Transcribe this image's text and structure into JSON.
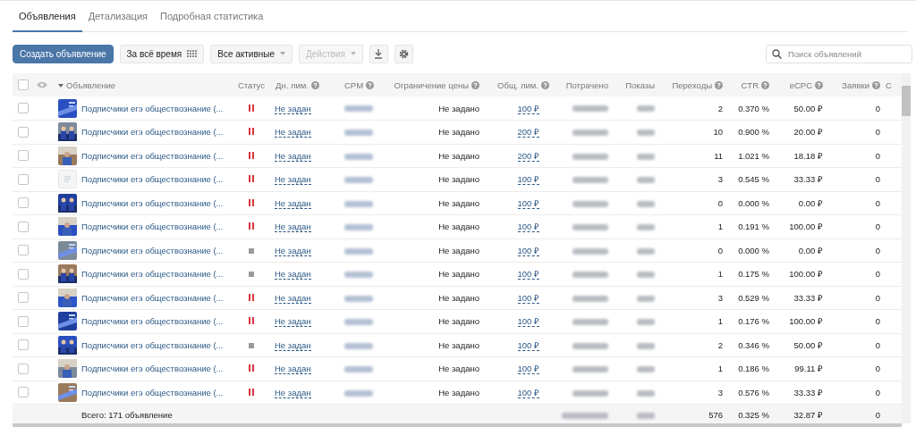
{
  "tabs": [
    {
      "label": "Объявления",
      "selected": true
    },
    {
      "label": "Детализация",
      "selected": false
    },
    {
      "label": "Подробная статистика",
      "selected": false
    }
  ],
  "toolbar": {
    "create_button": "Создать объявление",
    "period": "За всё время",
    "filter": "Все активные",
    "actions": {
      "label": "Действия",
      "disabled": true
    }
  },
  "search": {
    "placeholder": "Поиск объявлений"
  },
  "table": {
    "select_all": {
      "checked": false
    },
    "columns": [
      {
        "label": "Объявление",
        "help": false,
        "sorted": true
      },
      {
        "label": "Статус",
        "help": false,
        "sorted": false
      },
      {
        "label": "Дн. лим.",
        "help": true,
        "sorted": false
      },
      {
        "label": "CPM",
        "help": true,
        "sorted": false
      },
      {
        "label": "Ограничение цены",
        "help": true,
        "sorted": false
      },
      {
        "label": "Общ. лим.",
        "help": true,
        "sorted": false
      },
      {
        "label": "Потрачено",
        "help": false,
        "sorted": false
      },
      {
        "label": "Показы",
        "help": false,
        "sorted": false
      },
      {
        "label": "Переходы",
        "help": true,
        "sorted": false
      },
      {
        "label": "CTR",
        "help": true,
        "sorted": false
      },
      {
        "label": "eCPC",
        "help": true,
        "sorted": false
      },
      {
        "label": "Заявки",
        "help": true,
        "sorted": false
      },
      {
        "label": "С",
        "help": false,
        "sorted": false
      }
    ],
    "rows": [
      {
        "checked": false,
        "has_image": true,
        "title": "Подписчики егэ обществознание (...",
        "paused": true,
        "daily_limit": "Не задан",
        "price_limit": "Не задано",
        "total_limit": "100 ₽",
        "clicks": "2",
        "ctr": "0.370 %",
        "ecpc": "50.00 ₽",
        "leads": "0"
      },
      {
        "checked": false,
        "has_image": true,
        "title": "Подписчики егэ обществознание (...",
        "paused": true,
        "daily_limit": "Не задан",
        "price_limit": "Не задано",
        "total_limit": "200 ₽",
        "clicks": "10",
        "ctr": "0.900 %",
        "ecpc": "20.00 ₽",
        "leads": "0"
      },
      {
        "checked": false,
        "has_image": true,
        "title": "Подписчики егэ обществознание (...",
        "paused": true,
        "daily_limit": "Не задан",
        "price_limit": "Не задано",
        "total_limit": "200 ₽",
        "clicks": "11",
        "ctr": "1.021 %",
        "ecpc": "18.18 ₽",
        "leads": "0"
      },
      {
        "checked": false,
        "has_image": false,
        "title": "Подписчики егэ обществознание (...",
        "paused": true,
        "daily_limit": "Не задан",
        "price_limit": "Не задано",
        "total_limit": "100 ₽",
        "clicks": "3",
        "ctr": "0.545 %",
        "ecpc": "33.33 ₽",
        "leads": "0"
      },
      {
        "checked": false,
        "has_image": true,
        "title": "Подписчики егэ обществознание (...",
        "paused": true,
        "daily_limit": "Не задан",
        "price_limit": "Не задано",
        "total_limit": "100 ₽",
        "clicks": "0",
        "ctr": "0.000 %",
        "ecpc": "0.00 ₽",
        "leads": "0"
      },
      {
        "checked": false,
        "has_image": true,
        "title": "Подписчики егэ обществознание (...",
        "paused": true,
        "daily_limit": "Не задан",
        "price_limit": "Не задано",
        "total_limit": "100 ₽",
        "clicks": "1",
        "ctr": "0.191 %",
        "ecpc": "100.00 ₽",
        "leads": "0"
      },
      {
        "checked": false,
        "has_image": true,
        "title": "Подписчики егэ обществознание (...",
        "paused": false,
        "daily_limit": "Не задан",
        "price_limit": "Не задано",
        "total_limit": "100 ₽",
        "clicks": "0",
        "ctr": "0.000 %",
        "ecpc": "0.00 ₽",
        "leads": "0"
      },
      {
        "checked": false,
        "has_image": true,
        "title": "Подписчики егэ обществознание (...",
        "paused": false,
        "daily_limit": "Не задан",
        "price_limit": "Не задано",
        "total_limit": "100 ₽",
        "clicks": "1",
        "ctr": "0.175 %",
        "ecpc": "100.00 ₽",
        "leads": "0"
      },
      {
        "checked": false,
        "has_image": true,
        "title": "Подписчики егэ обществознание (...",
        "paused": true,
        "daily_limit": "Не задан",
        "price_limit": "Не задано",
        "total_limit": "100 ₽",
        "clicks": "3",
        "ctr": "0.529 %",
        "ecpc": "33.33 ₽",
        "leads": "0"
      },
      {
        "checked": false,
        "has_image": true,
        "title": "Подписчики егэ обществознание (...",
        "paused": true,
        "daily_limit": "Не задан",
        "price_limit": "Не задано",
        "total_limit": "100 ₽",
        "clicks": "1",
        "ctr": "0.176 %",
        "ecpc": "100.00 ₽",
        "leads": "0"
      },
      {
        "checked": false,
        "has_image": true,
        "title": "Подписчики егэ обществознание (...",
        "paused": false,
        "daily_limit": "Не задан",
        "price_limit": "Не задано",
        "total_limit": "100 ₽",
        "clicks": "2",
        "ctr": "0.346 %",
        "ecpc": "50.00 ₽",
        "leads": "0"
      },
      {
        "checked": false,
        "has_image": true,
        "title": "Подписчики егэ обществознание (...",
        "paused": true,
        "daily_limit": "Не задан",
        "price_limit": "Не задано",
        "total_limit": "100 ₽",
        "clicks": "1",
        "ctr": "0.186 %",
        "ecpc": "99.11 ₽",
        "leads": "0"
      },
      {
        "checked": false,
        "has_image": true,
        "title": "Подписчики егэ обществознание (...",
        "paused": true,
        "daily_limit": "Не задан",
        "price_limit": "Не задано",
        "total_limit": "100 ₽",
        "clicks": "3",
        "ctr": "0.576 %",
        "ecpc": "33.33 ₽",
        "leads": "0"
      }
    ],
    "footer": {
      "total": "Всего: 171 объявление",
      "clicks": "576",
      "ctr": "0.325 %",
      "ecpc": "32.87 ₽",
      "leads": "0"
    }
  }
}
